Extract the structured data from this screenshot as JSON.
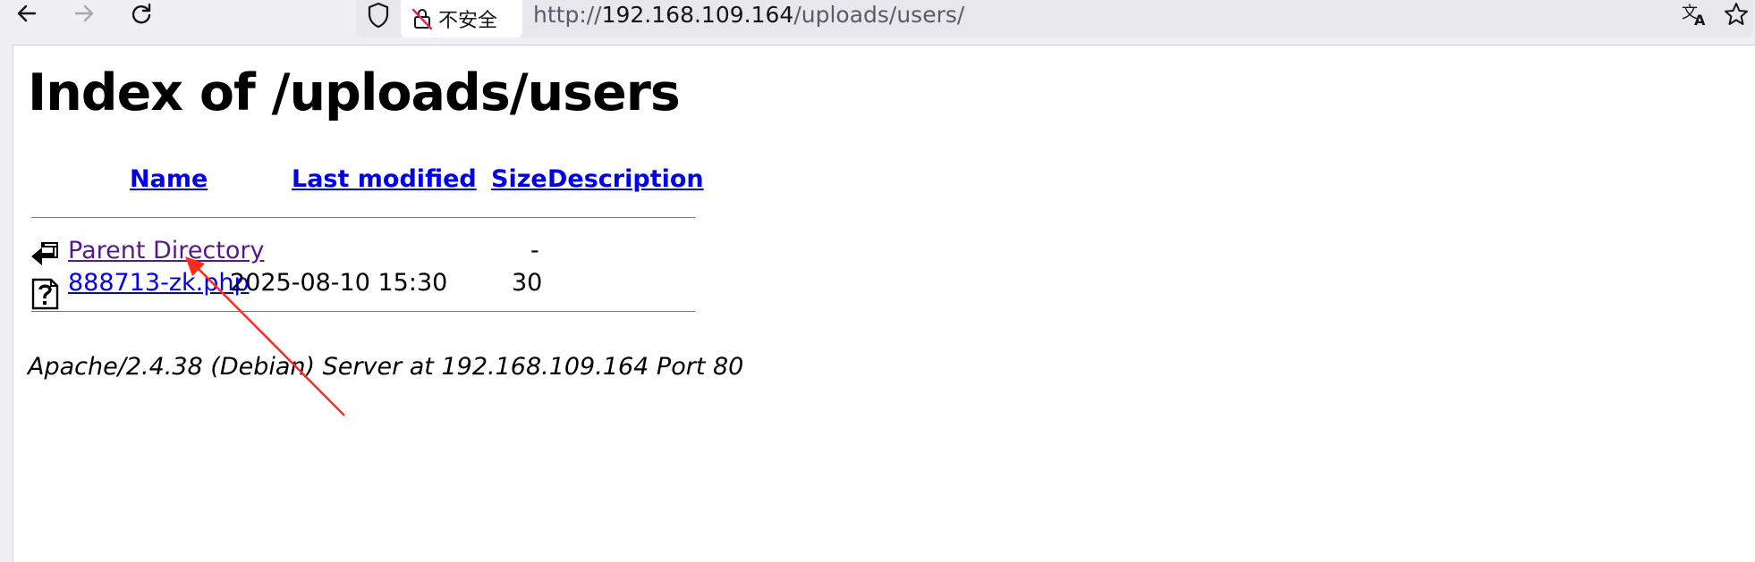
{
  "browser": {
    "security_label": "不安全",
    "url": {
      "scheme": "http://",
      "host": "192.168.109.164",
      "path": "/uploads/users/"
    },
    "icons": [
      "back-arrow-icon",
      "forward-arrow-icon",
      "reload-icon",
      "shield-icon",
      "insecure-lock-icon",
      "translate-icon",
      "bookmark-star-icon"
    ]
  },
  "page": {
    "title": "Index of /uploads/users",
    "columns": {
      "name": "Name",
      "last_modified": "Last modified",
      "size": "Size",
      "description": "Description"
    },
    "rows": [
      {
        "icon": "back-icon",
        "name": "Parent Directory",
        "last_modified": "",
        "size": "-",
        "description": ""
      },
      {
        "icon": "unknown-file-icon",
        "name": "888713-zk.php",
        "last_modified": "2025-08-10 15:30",
        "size": "30",
        "description": ""
      }
    ],
    "signature": "Apache/2.4.38 (Debian) Server at 192.168.109.164 Port 80"
  },
  "colors": {
    "link": "#0000ee",
    "visited_link": "#551a8b",
    "annotation_arrow": "#ff2a1a"
  }
}
